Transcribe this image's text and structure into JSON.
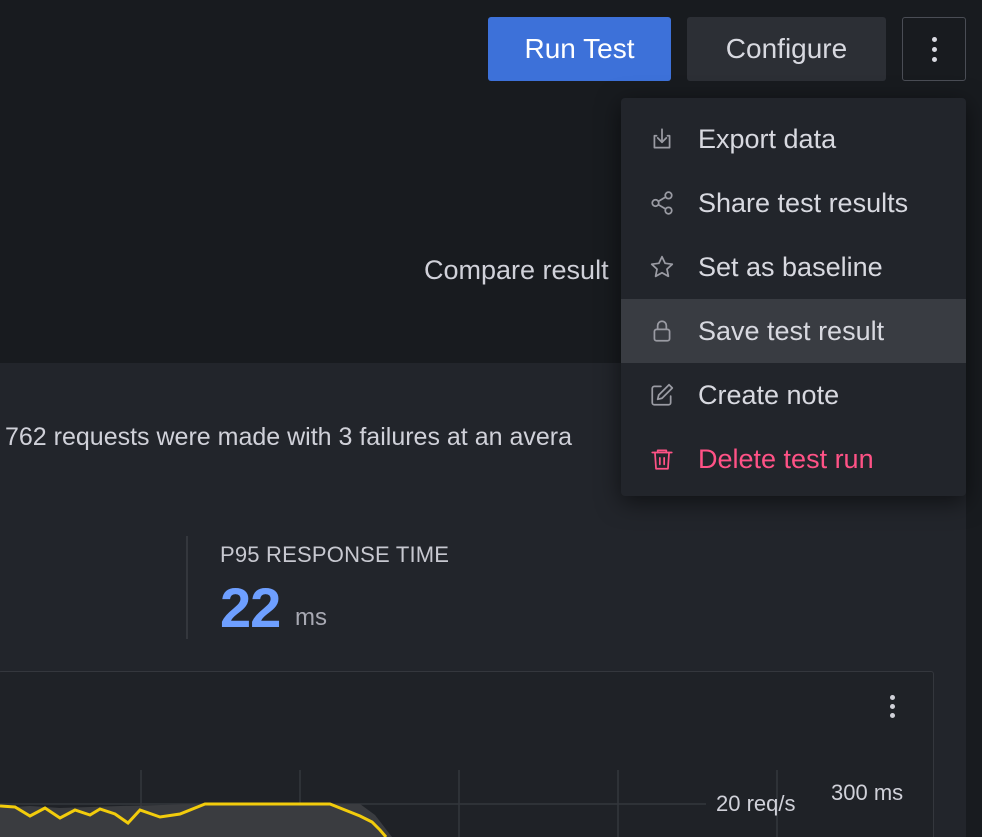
{
  "toolbar": {
    "run_label": "Run Test",
    "configure_label": "Configure"
  },
  "header": {
    "compare_text": "Compare result"
  },
  "summary": {
    "text": "762 requests were made with 3 failures at an avera",
    "stat_label": "P95 RESPONSE TIME",
    "stat_value": "22",
    "stat_unit": "ms"
  },
  "chart": {
    "left_axis_label": "20 req/s",
    "right_axis_label": "300 ms"
  },
  "menu": {
    "items": [
      {
        "label": "Export data",
        "icon": "download-icon"
      },
      {
        "label": "Share test results",
        "icon": "share-icon"
      },
      {
        "label": "Set as baseline",
        "icon": "star-icon"
      },
      {
        "label": "Save test result",
        "icon": "lock-icon"
      },
      {
        "label": "Create note",
        "icon": "edit-icon"
      },
      {
        "label": "Delete test run",
        "icon": "trash-icon"
      }
    ]
  },
  "colors": {
    "primary": "#3d71d9",
    "danger": "#ff5286",
    "stat_accent": "#6e9fff",
    "series_line": "#f2cc0c"
  }
}
